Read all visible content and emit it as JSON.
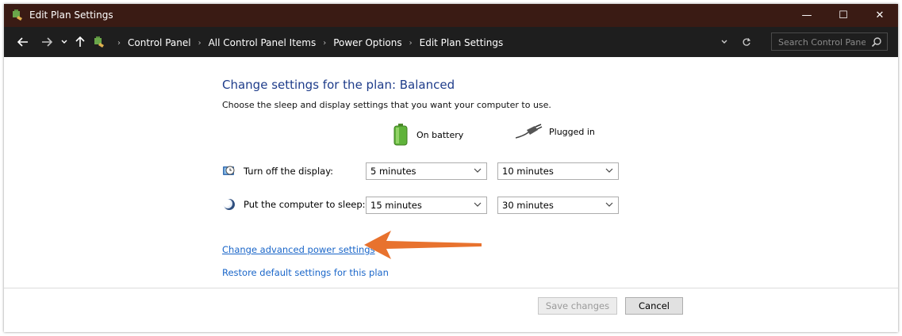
{
  "window": {
    "title": "Edit Plan Settings",
    "controls": {
      "minimize": "—",
      "maximize": "☐",
      "close": "✕"
    }
  },
  "addressbar": {
    "breadcrumbs": [
      "Control Panel",
      "All Control Panel Items",
      "Power Options",
      "Edit Plan Settings"
    ],
    "search_placeholder": "Search Control Panel"
  },
  "main": {
    "heading": "Change settings for the plan: Balanced",
    "subheading": "Choose the sleep and display settings that you want your computer to use.",
    "columns": {
      "battery": "On battery",
      "plugged": "Plugged in"
    },
    "rows": [
      {
        "label": "Turn off the display:",
        "battery": "5 minutes",
        "plugged": "10 minutes"
      },
      {
        "label": "Put the computer to sleep:",
        "battery": "15 minutes",
        "plugged": "30 minutes"
      }
    ],
    "links": {
      "advanced": "Change advanced power settings",
      "restore": "Restore default settings for this plan"
    }
  },
  "footer": {
    "save": "Save changes",
    "cancel": "Cancel"
  },
  "colors": {
    "titlebar": "#3a1b14",
    "addressbar": "#1e1e1e",
    "heading": "#1e3c8a",
    "link": "#1a66c9",
    "annotation_arrow": "#e8722e"
  }
}
